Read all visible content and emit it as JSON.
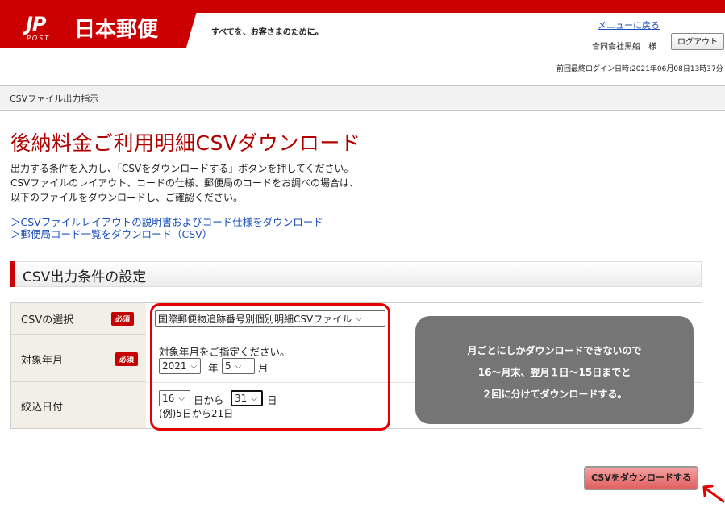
{
  "header": {
    "logo_mark": "JP",
    "logo_post": "POST",
    "logo_name": "日本郵便",
    "tagline": "すべてを、お客さまのために。",
    "menu_link": "メニューに戻る",
    "user_name": "合同会社黒船　様",
    "logout_label": "ログアウト",
    "last_login": "前回最終ログイン日時:2021年06月08日13時37分"
  },
  "breadcrumb": "CSVファイル出力指示",
  "page_title": "後納料金ご利用明細CSVダウンロード",
  "description": [
    "出力する条件を入力し、「CSVをダウンロードする」ボタンを押してください。",
    "CSVファイルのレイアウト、コードの仕様、郵便局のコードをお調べの場合は、",
    "以下のファイルをダウンロードし、ご確認ください。"
  ],
  "links": {
    "layout_doc": "＞CSVファイルレイアウトの説明書およびコード仕様をダウンロード",
    "post_office_list": "＞郵便局コード一覧をダウンロード（CSV）"
  },
  "section_title": "CSV出力条件の設定",
  "required_badge": "必須",
  "form": {
    "csv_select": {
      "label": "CSVの選択",
      "value": "国際郵便物追跡番号別個別明細CSVファイル"
    },
    "target_month": {
      "label": "対象年月",
      "hint": "対象年月をご指定ください。",
      "year": "2021",
      "year_unit": "年",
      "month": "5",
      "month_unit": "月"
    },
    "narrow_date": {
      "label": "絞込日付",
      "from": "16",
      "from_suffix": "日から",
      "to": "31",
      "to_suffix": "日",
      "example": "(例)5日から21日"
    }
  },
  "callout": [
    "月ごとにしかダウンロードできないので",
    "16～月末、翌月１日～15日までと",
    "２回に分けてダウンロードする。"
  ],
  "download_button": "CSVをダウンロードする",
  "colors": {
    "brand_red": "#cc0000",
    "highlight_red": "#e30000",
    "callout_gray": "#757575",
    "link_blue": "#1a4fbf"
  }
}
